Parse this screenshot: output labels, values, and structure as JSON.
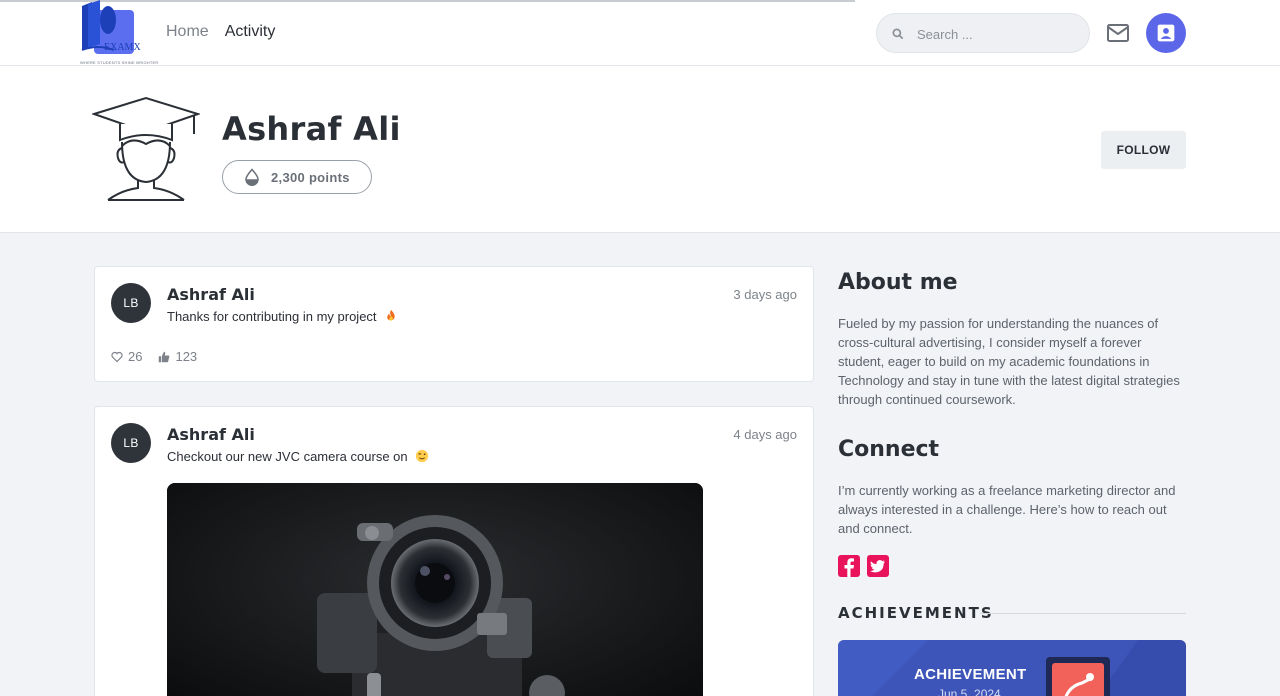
{
  "header": {
    "logo_text": "EXAMX",
    "logo_tagline": "WHERE STUDENTS SHINE BRIGHTER",
    "nav": [
      {
        "label": "Home"
      },
      {
        "label": "Activity"
      }
    ],
    "search_placeholder": "Search ...",
    "icons": {
      "search": "search-icon",
      "mail": "mail-icon",
      "account": "account-box-icon"
    },
    "accent_color": "#5b67e8"
  },
  "profile": {
    "name": "Ashraf Ali",
    "points": "2,300 points",
    "follow_label": "FOLLOW"
  },
  "posts": [
    {
      "avatar_initials": "LB",
      "author": "Ashraf Ali",
      "time": "3 days ago",
      "text": "Thanks for contributing in my project",
      "emoji": "fire",
      "likes": "26",
      "thumbs": "123"
    },
    {
      "avatar_initials": "LB",
      "author": "Ashraf Ali",
      "time": "4 days ago",
      "text": "Checkout our new JVC camera course on",
      "emoji": "wink"
    }
  ],
  "sidebar": {
    "about_title": "About me",
    "about_text": "Fueled by my passion for understanding the nuances of cross-cultural advertising, I consider myself a forever student, eager to build on my academic foundations in Technology and stay in tune with the latest digital strategies through continued coursework.",
    "connect_title": "Connect",
    "connect_text": "I’m currently working as a freelance marketing director and always interested in a challenge. Here’s how to reach out and connect.",
    "social_color": "#e8135a",
    "achievements_title": "ACHIEVEMENTS",
    "achievement_label": "ACHIEVEMENT",
    "achievement_date": "Jun 5, 2024"
  }
}
